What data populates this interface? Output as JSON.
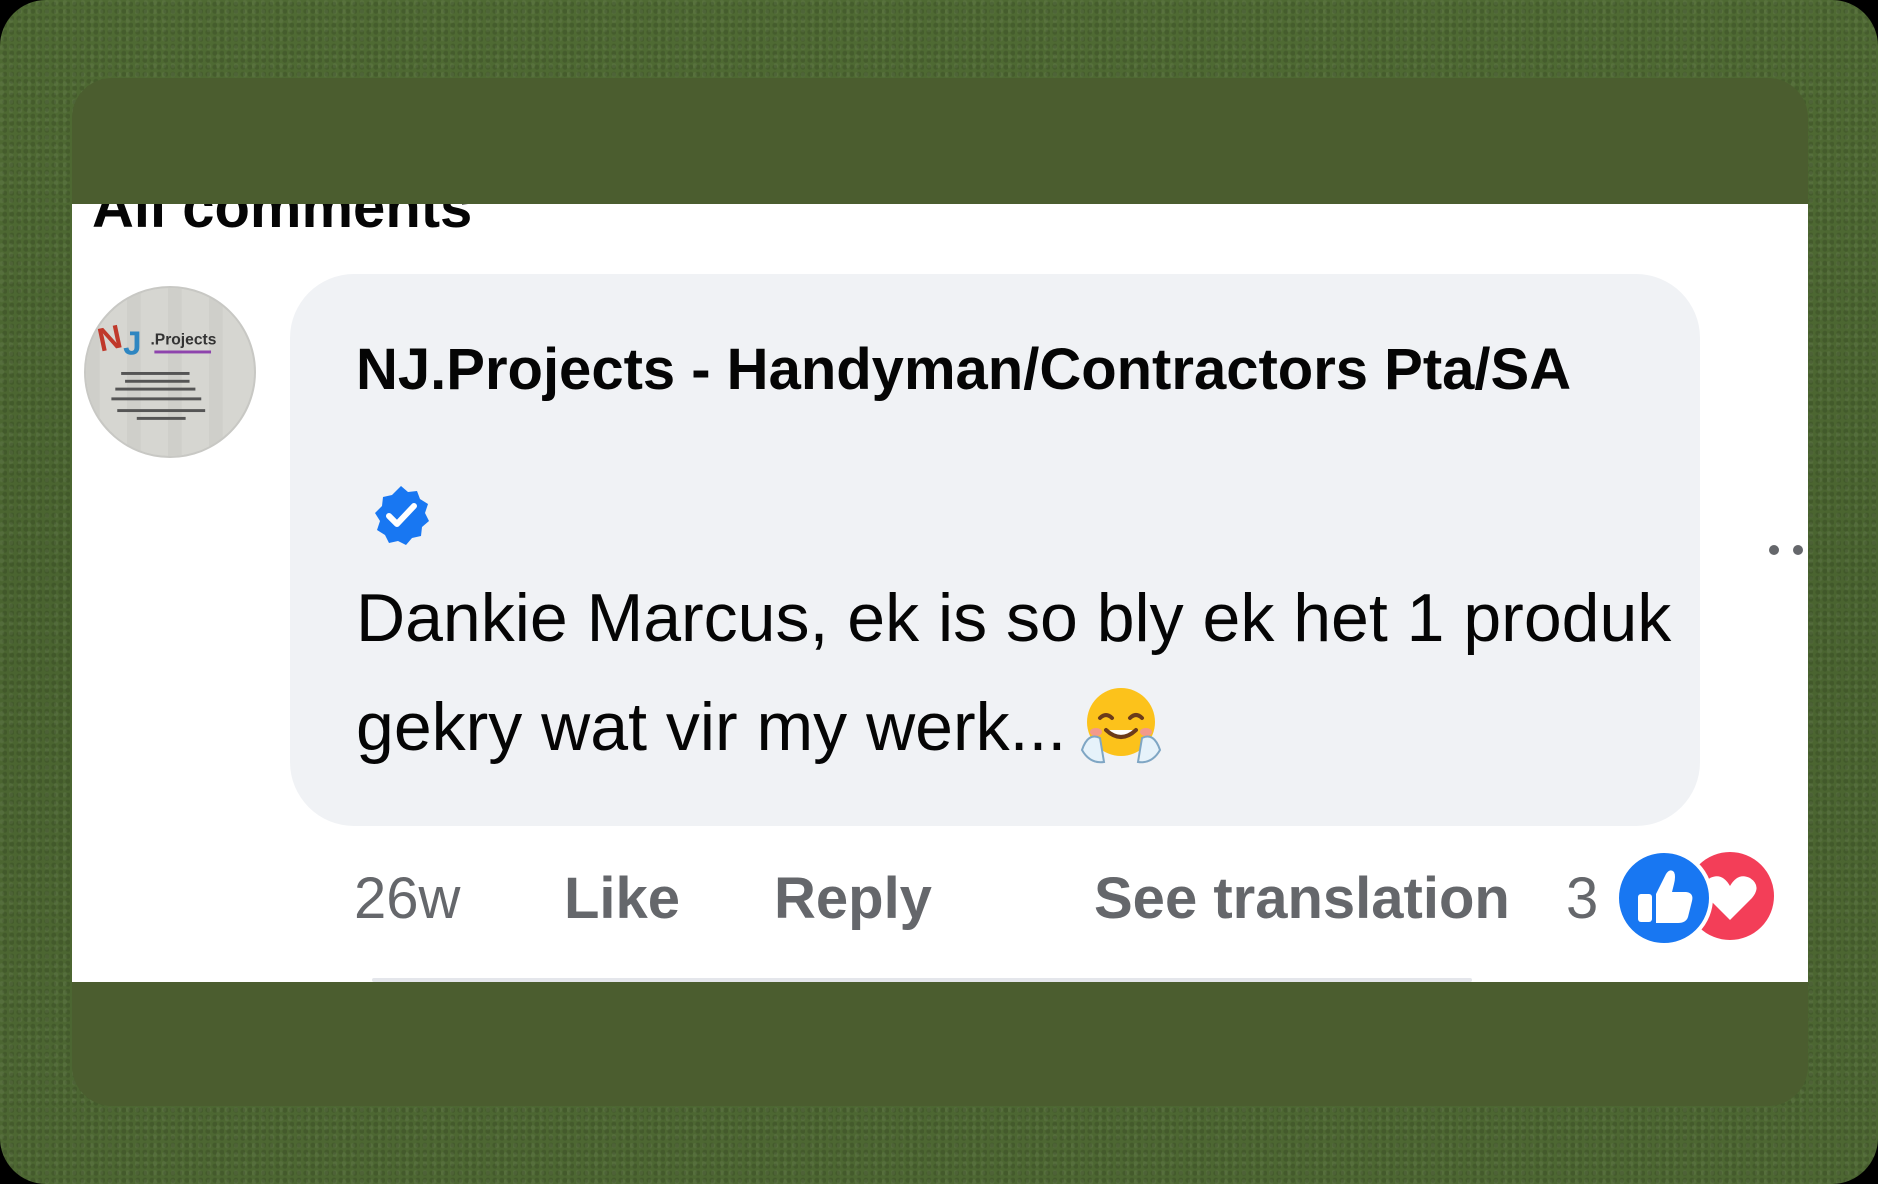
{
  "section": {
    "header_partial": "All comments"
  },
  "comment": {
    "author": "NJ.Projects - Handyman/Contractors Pta/SA",
    "avatar_text": ".Projects",
    "avatar_logo": "NJ",
    "verified_icon": "verified-badge-icon",
    "text": "Dankie Marcus, ek is so bly ek het 1 produk gekry wat vir my werk...",
    "emoji_icon": "hugging-face-emoji-icon",
    "more_icon": "more-options-icon"
  },
  "actions": {
    "time": "26w",
    "like": "Like",
    "reply": "Reply",
    "see_translation": "See translation"
  },
  "reactions": {
    "count": "3",
    "types": [
      "like-reaction-icon",
      "love-reaction-icon"
    ]
  },
  "colors": {
    "facebook_blue": "#1877f2",
    "love_red": "#f33e58",
    "bubble_bg": "#f0f2f5",
    "secondary_text": "#65676b"
  }
}
